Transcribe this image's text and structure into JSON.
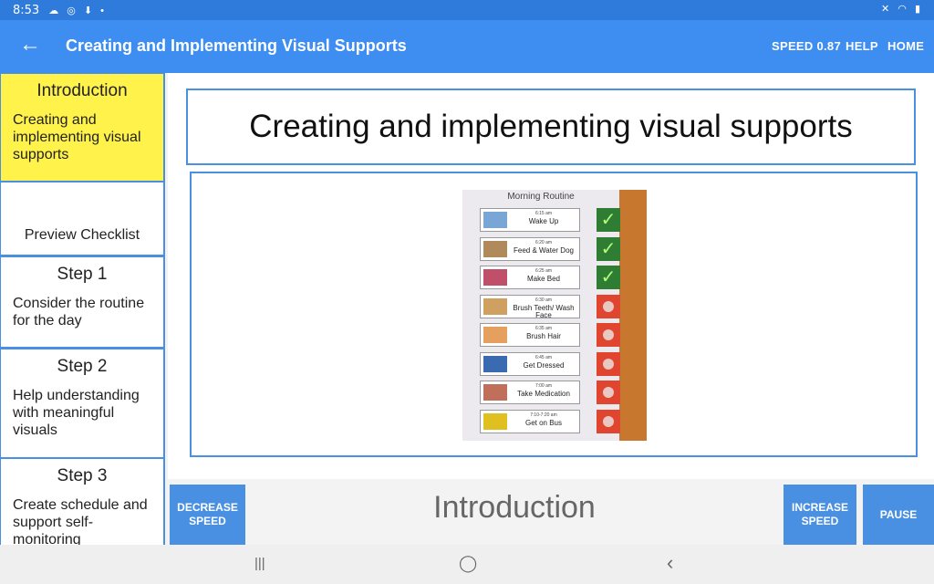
{
  "status_bar": {
    "time": "8:53",
    "left_icons": "☁ ◎ ⬇ •",
    "right_icons": "✕ ◠ ▮"
  },
  "app_bar": {
    "title": "Creating and Implementing Visual Supports",
    "back_icon": "←",
    "actions": {
      "speed": "SPEED 0.87",
      "help": "HELP",
      "home": "HOME"
    }
  },
  "sidebar": {
    "items": [
      {
        "heading": "Introduction",
        "description": "Creating and implementing visual supports",
        "active": true
      },
      {
        "heading": "",
        "description": "Preview Checklist",
        "active": false
      },
      {
        "heading": "Step 1",
        "description": "Consider the routine for the day",
        "active": false
      },
      {
        "heading": "Step 2",
        "description": "Help understanding with meaningful visuals",
        "active": false
      },
      {
        "heading": "Step 3",
        "description": "Create schedule and support self-monitoring",
        "active": false
      }
    ]
  },
  "main": {
    "slide_title": "Creating and implementing visual supports",
    "image": {
      "board_title": "Morning Routine",
      "cards": [
        {
          "time": "6:15 am",
          "label": "Wake Up",
          "status": "done"
        },
        {
          "time": "6:20 am",
          "label": "Feed & Water Dog",
          "status": "done"
        },
        {
          "time": "6:25 am",
          "label": "Make Bed",
          "status": "done"
        },
        {
          "time": "6:30 am",
          "label": "Brush Teeth/ Wash Face",
          "status": "todo"
        },
        {
          "time": "6:35 am",
          "label": "Brush Hair",
          "status": "todo"
        },
        {
          "time": "6:45 am",
          "label": "Get Dressed",
          "status": "todo"
        },
        {
          "time": "7:00 am",
          "label": "Take Medication",
          "status": "todo"
        },
        {
          "time": "7:10-7:20 am",
          "label": "Get on Bus",
          "status": "todo"
        }
      ]
    }
  },
  "controls": {
    "decrease_speed": "DECREASE SPEED",
    "section_title": "Introduction",
    "increase_speed": "INCREASE SPEED",
    "pause": "PAUSE"
  },
  "nav_bar": {
    "recents": "|||",
    "home": "◯",
    "back": "‹"
  },
  "colors": {
    "app_bar": "#3d8ef0",
    "status_bar": "#2f7bdc",
    "active_item": "#fff24a",
    "accent": "#4a90e2"
  }
}
